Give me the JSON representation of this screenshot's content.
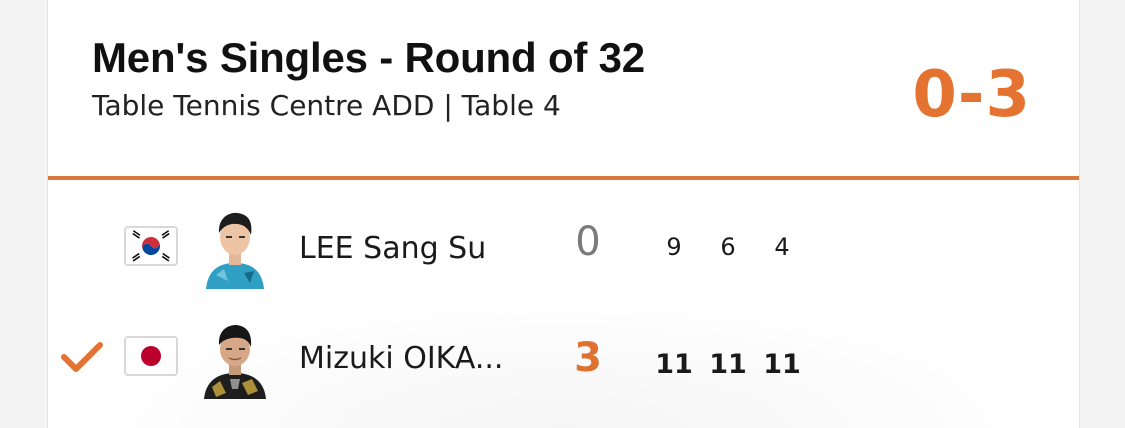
{
  "match": {
    "title": "Men's Singles - Round of 32",
    "venue": "Table Tennis Centre ADD | Table 4",
    "score": "0-3"
  },
  "colors": {
    "accent": "#e47331",
    "divider": "#d9773f",
    "loser_sets": "#7a7a7a",
    "text": "#1a1a1a"
  },
  "players": [
    {
      "name": "LEE Sang Su",
      "flag": "south-korea-flag",
      "sets": "0",
      "winner": false,
      "games": [
        "9",
        "6",
        "4"
      ]
    },
    {
      "name": "Mizuki OIKA...",
      "flag": "japan-flag",
      "sets": "3",
      "winner": true,
      "winner_icon": "checkmark-icon",
      "games": [
        "11",
        "11",
        "11"
      ]
    }
  ]
}
